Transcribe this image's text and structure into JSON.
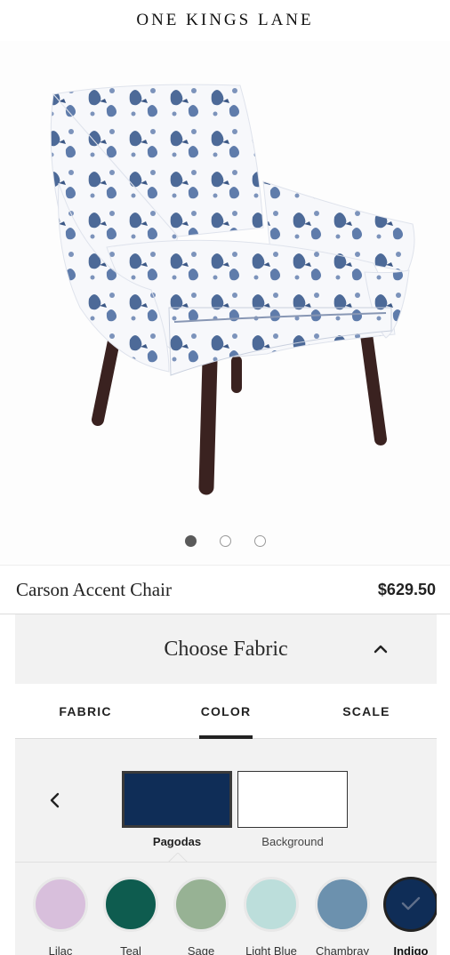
{
  "header": {
    "brand": "ONE KINGS LANE"
  },
  "gallery": {
    "image_icon": "accent-chair-photo",
    "dot_count": 3,
    "active_index": 0
  },
  "product": {
    "name": "Carson Accent Chair",
    "price": "$629.50"
  },
  "customizer": {
    "title": "Choose Fabric",
    "collapse_icon": "chevron-up-icon",
    "tabs": [
      {
        "label": "FABRIC",
        "active": false
      },
      {
        "label": "COLOR",
        "active": true
      },
      {
        "label": "SCALE",
        "active": false
      }
    ],
    "back_icon": "chevron-left-icon",
    "layers": [
      {
        "label": "Pagodas",
        "color": "#0f2d57",
        "selected": true
      },
      {
        "label": "Background",
        "color": "#ffffff",
        "selected": false
      }
    ],
    "colors": [
      {
        "label": "Lilac",
        "color": "#d8bfdc"
      },
      {
        "label": "Teal",
        "color": "#0e5c4f"
      },
      {
        "label": "Sage",
        "color": "#97b294"
      },
      {
        "label": "Light Blue",
        "color": "#bcdedb"
      },
      {
        "label": "Chambray",
        "color": "#6c91ae"
      },
      {
        "label": "Indigo",
        "color": "#0f2d57",
        "selected": true
      }
    ],
    "selected_icon": "checkmark-icon"
  }
}
